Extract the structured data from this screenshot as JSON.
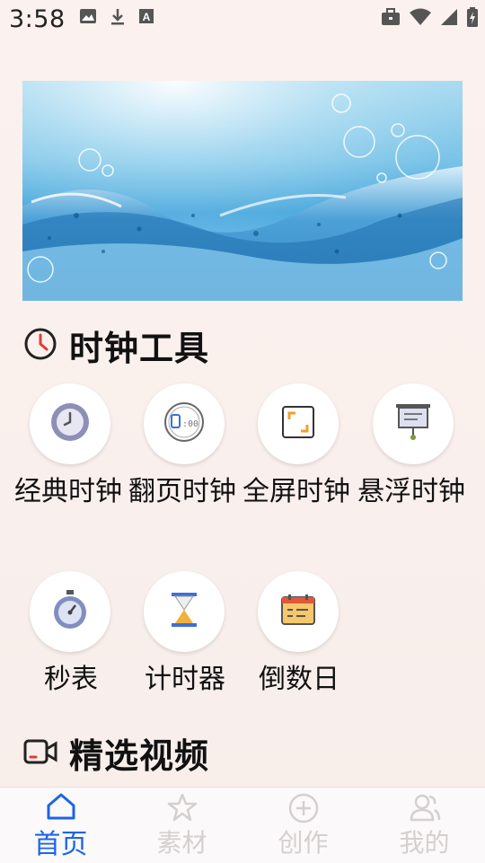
{
  "status_bar": {
    "time": "3:58",
    "left_icons": [
      "image-icon",
      "download-icon",
      "text-a-icon"
    ],
    "right_icons": [
      "briefcase-icon",
      "wifi-icon",
      "signal-icon",
      "battery-icon"
    ]
  },
  "banner": {
    "description_icon": "water-wave-image"
  },
  "clock_tools": {
    "title": "时钟工具",
    "icon": "clock-icon",
    "items": [
      {
        "label": "经典时钟",
        "icon": "analog-clock-icon"
      },
      {
        "label": "翻页时钟",
        "icon": "digital-clock-icon"
      },
      {
        "label": "全屏时钟",
        "icon": "fullscreen-icon"
      },
      {
        "label": "悬浮时钟",
        "icon": "presentation-board-icon"
      },
      {
        "label": "秒表",
        "icon": "stopwatch-icon"
      },
      {
        "label": "计时器",
        "icon": "hourglass-icon"
      },
      {
        "label": "倒数日",
        "icon": "calendar-icon"
      }
    ]
  },
  "featured_videos": {
    "title": "精选视频",
    "icon": "video-camera-icon"
  },
  "bottom_nav": {
    "items": [
      {
        "label": "首页",
        "icon": "home-icon",
        "active": true
      },
      {
        "label": "素材",
        "icon": "star-icon",
        "active": false
      },
      {
        "label": "创作",
        "icon": "plus-circle-icon",
        "active": false
      },
      {
        "label": "我的",
        "icon": "users-icon",
        "active": false
      }
    ],
    "active_color": "#1e64e6",
    "inactive_color": "#d3d0cf"
  }
}
